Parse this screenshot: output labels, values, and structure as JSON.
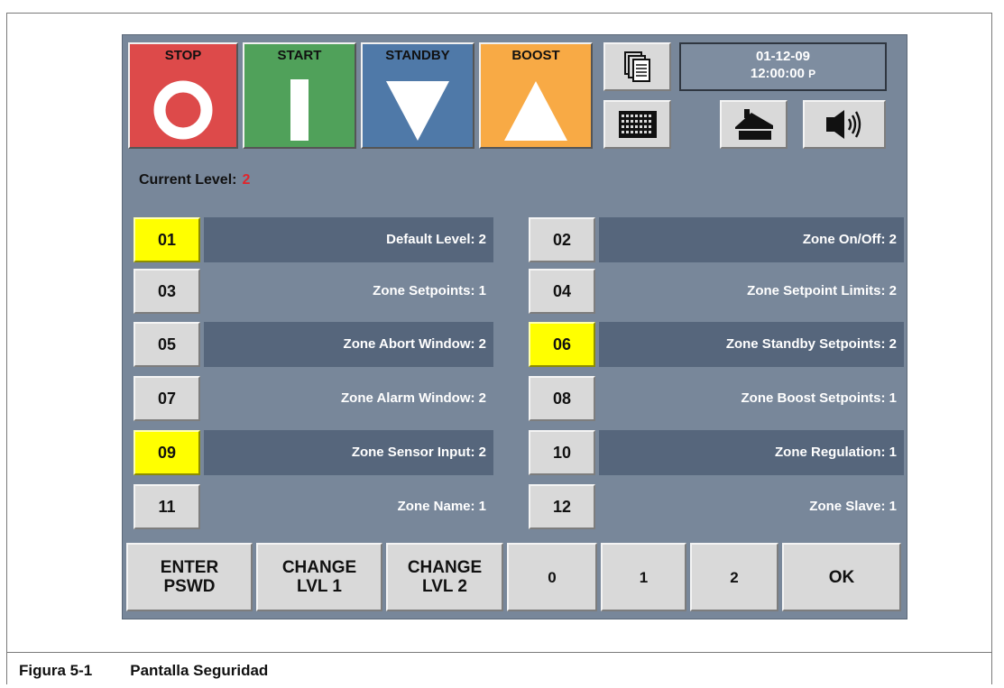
{
  "modes": [
    {
      "label": "STOP",
      "color": "#dd4a4a",
      "symbol": "circle"
    },
    {
      "label": "START",
      "color": "#50a15a",
      "symbol": "bar"
    },
    {
      "label": "STANDBY",
      "color": "#4f79a8",
      "symbol": "triangle-down"
    },
    {
      "label": "BOOST",
      "color": "#f8aa45",
      "symbol": "triangle-up"
    }
  ],
  "datetime": {
    "date": "01-12-09",
    "time": "12:00:00",
    "ampm": "P"
  },
  "icons": [
    "copy-screens-icon",
    "keypad-icon",
    "home-icon",
    "speaker-icon"
  ],
  "current_level": {
    "label": "Current Level:",
    "value": "2"
  },
  "rows": [
    {
      "num": "01",
      "label": "Default Level: 2",
      "highlight": true
    },
    {
      "num": "02",
      "label": "Zone On/Off: 2",
      "highlight": false
    },
    {
      "num": "03",
      "label": "Zone Setpoints: 1",
      "highlight": false
    },
    {
      "num": "04",
      "label": "Zone Setpoint Limits: 2",
      "highlight": false
    },
    {
      "num": "05",
      "label": "Zone Abort Window: 2",
      "highlight": false
    },
    {
      "num": "06",
      "label": "Zone Standby Setpoints: 2",
      "highlight": true
    },
    {
      "num": "07",
      "label": "Zone Alarm Window: 2",
      "highlight": false
    },
    {
      "num": "08",
      "label": "Zone Boost Setpoints: 1",
      "highlight": false
    },
    {
      "num": "09",
      "label": "Zone Sensor Input: 2",
      "highlight": true
    },
    {
      "num": "10",
      "label": "Zone Regulation: 1",
      "highlight": false
    },
    {
      "num": "11",
      "label": "Zone Name: 1",
      "highlight": false
    },
    {
      "num": "12",
      "label": "Zone Slave: 1",
      "highlight": false
    }
  ],
  "bottom_buttons": [
    {
      "line1": "ENTER",
      "line2": "PSWD"
    },
    {
      "line1": "CHANGE",
      "line2": "LVL 1"
    },
    {
      "line1": "CHANGE",
      "line2": "LVL 2"
    },
    {
      "line1": "0",
      "line2": ""
    },
    {
      "line1": "1",
      "line2": ""
    },
    {
      "line1": "2",
      "line2": ""
    },
    {
      "line1": "OK",
      "line2": ""
    }
  ],
  "caption": {
    "number": "Figura 5-1",
    "title": "Pantalla Seguridad"
  }
}
